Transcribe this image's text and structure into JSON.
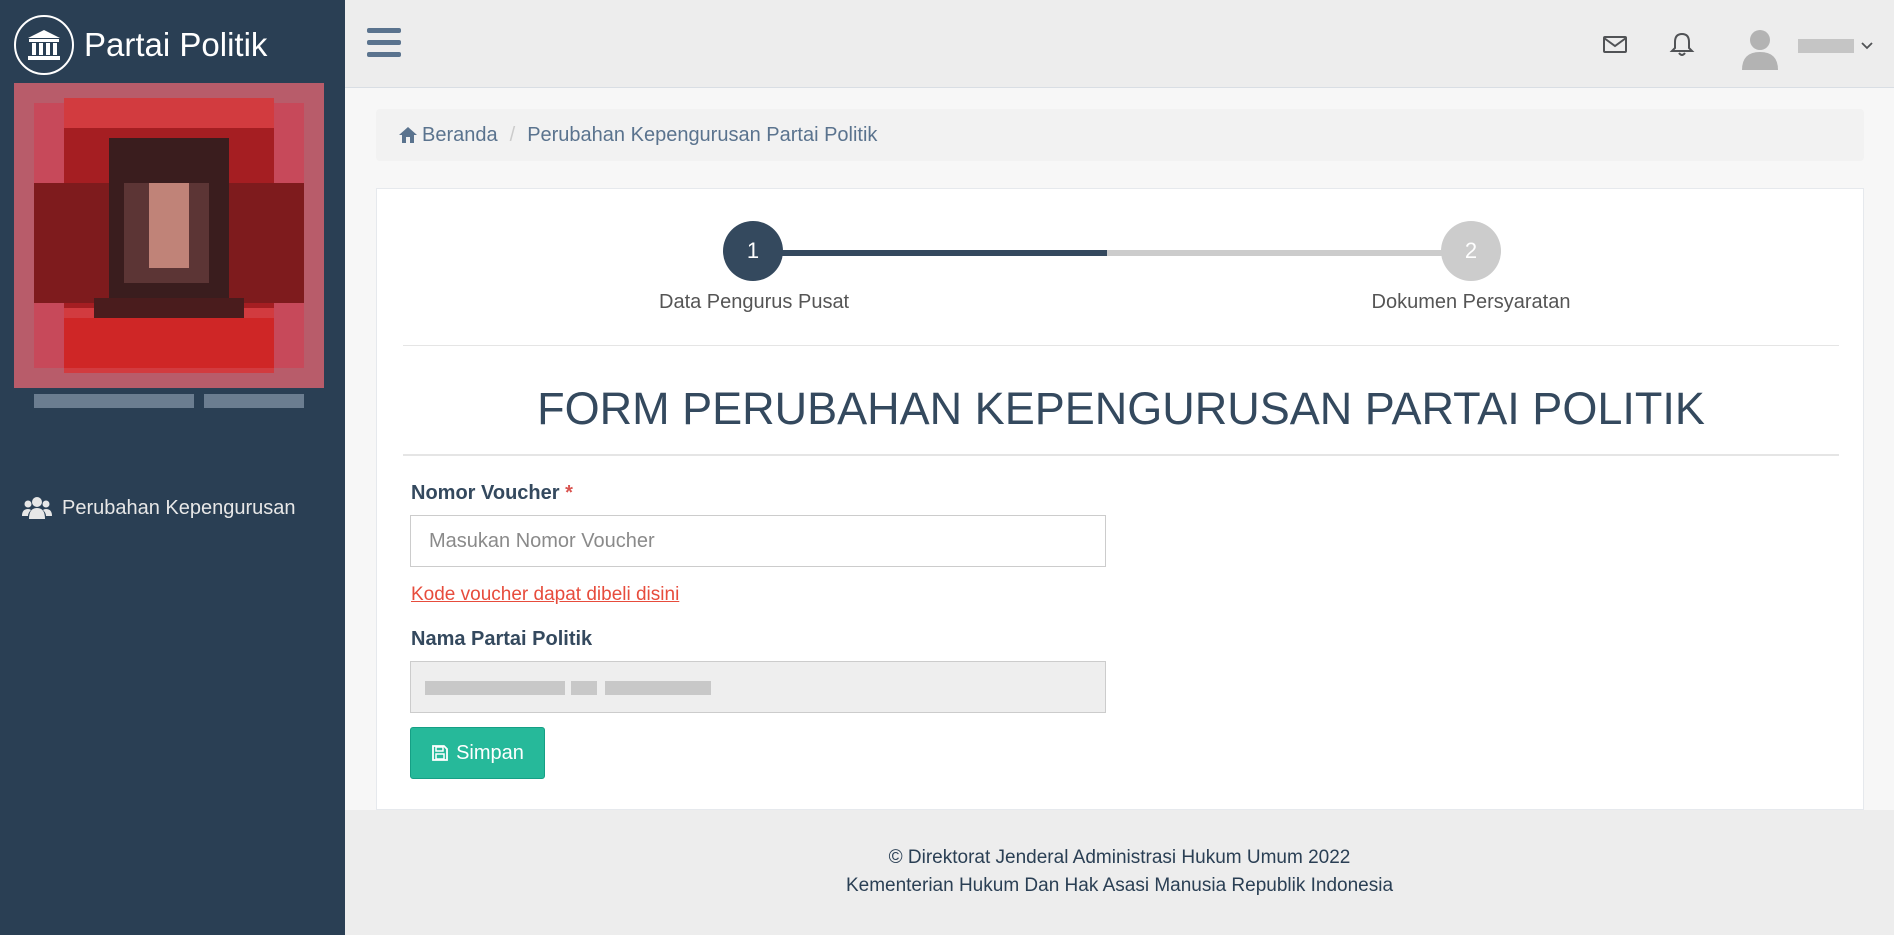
{
  "sidebar": {
    "brand_title": "Partai Politik",
    "brand_icon": "institution-icon",
    "nav_items": [
      {
        "label": "Perubahan Kepengurusan",
        "icon": "users-icon"
      }
    ]
  },
  "topnav": {
    "menu_icon": "hamburger-menu-icon",
    "mail_icon": "envelope-icon",
    "bell_icon": "bell-icon",
    "user_icon": "user-avatar-icon"
  },
  "breadcrumb": {
    "home": "Beranda",
    "current": "Perubahan Kepengurusan Partai Politik"
  },
  "wizard": {
    "steps": [
      {
        "number": "1",
        "label": "Data Pengurus Pusat",
        "active": true
      },
      {
        "number": "2",
        "label": "Dokumen Persyaratan",
        "active": false
      }
    ]
  },
  "form": {
    "title": "FORM PERUBAHAN KEPENGURUSAN PARTAI POLITIK",
    "voucher_label": "Nomor Voucher",
    "required_mark": "*",
    "voucher_placeholder": "Masukan Nomor Voucher",
    "voucher_value": "",
    "voucher_link": "Kode voucher dapat dibeli disini",
    "partai_label": "Nama Partai Politik",
    "save_button": "Simpan"
  },
  "footer": {
    "line1": "© Direktorat Jenderal Administrasi Hukum Umum 2022",
    "line2": "Kementerian Hukum Dan Hak Asasi Manusia Republik Indonesia"
  },
  "colors": {
    "sidebar": "#2a3f54",
    "accent": "#34495e",
    "success": "#26b99a",
    "danger": "#e74c3c"
  }
}
